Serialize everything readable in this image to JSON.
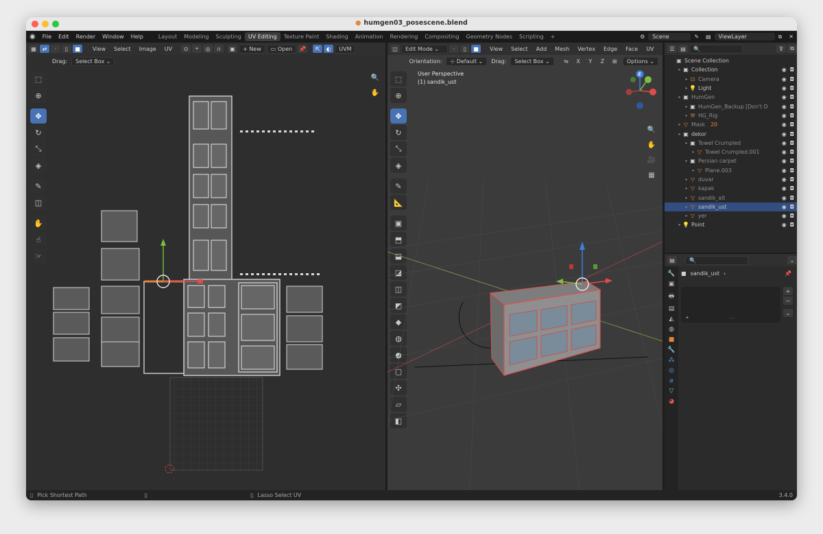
{
  "window": {
    "title": "humgen03_posescene.blend"
  },
  "topbar": {
    "menus": [
      "File",
      "Edit",
      "Render",
      "Window",
      "Help"
    ],
    "workspaces": [
      "Layout",
      "Modeling",
      "Sculpting",
      "UV Editing",
      "Texture Paint",
      "Shading",
      "Animation",
      "Rendering",
      "Compositing",
      "Geometry Nodes",
      "Scripting"
    ],
    "active_workspace": "UV Editing",
    "add_label": "+",
    "scene": "Scene",
    "view_layer": "ViewLayer"
  },
  "uv_editor": {
    "menus": [
      "View",
      "Select",
      "Image",
      "UV"
    ],
    "new_label": "New",
    "open_label": "Open",
    "uv_map_label": "UVM",
    "drag_label": "Drag:",
    "drag_mode": "Select Box"
  },
  "viewport": {
    "mode": "Edit Mode",
    "menus": [
      "View",
      "Select",
      "Add",
      "Mesh",
      "Vertex",
      "Edge",
      "Face",
      "UV"
    ],
    "orientation_label": "Orientation:",
    "orientation_value": "Default",
    "drag_label": "Drag:",
    "drag_mode": "Select Box",
    "axes": [
      "X",
      "Y",
      "Z"
    ],
    "options_label": "Options",
    "overlay_line1": "User Perspective",
    "overlay_line2": "(1) sandik_ust",
    "gizmo_axis_label": "Z"
  },
  "outliner": {
    "root": "Scene Collection",
    "rows": [
      {
        "label": "Collection",
        "indent": 1,
        "icon": "collection-icon",
        "dim": false
      },
      {
        "label": "Camera",
        "indent": 2,
        "icon": "camera-icon",
        "dim": true
      },
      {
        "label": "Light",
        "indent": 2,
        "icon": "light-icon",
        "dim": false
      },
      {
        "label": "HumGen",
        "indent": 1,
        "icon": "collection-icon",
        "dim": true
      },
      {
        "label": "HumGen_Backup [Don't D",
        "indent": 2,
        "icon": "collection-icon",
        "dim": true
      },
      {
        "label": "HG_Rig",
        "indent": 2,
        "icon": "armature-icon",
        "dim": true
      },
      {
        "label": "Mask",
        "indent": 1,
        "icon": "mesh-icon",
        "dim": true
      },
      {
        "label": "dekor",
        "indent": 1,
        "icon": "collection-icon",
        "dim": false
      },
      {
        "label": "Towel Crumpled",
        "indent": 2,
        "icon": "collection-icon",
        "dim": true
      },
      {
        "label": "Towel Crumpled.001",
        "indent": 3,
        "icon": "mesh-icon",
        "dim": true
      },
      {
        "label": "Persian carpet",
        "indent": 2,
        "icon": "collection-icon",
        "dim": true
      },
      {
        "label": "Plane.003",
        "indent": 3,
        "icon": "mesh-icon",
        "dim": true
      },
      {
        "label": "duvar",
        "indent": 2,
        "icon": "mesh-icon",
        "dim": true
      },
      {
        "label": "kapak",
        "indent": 2,
        "icon": "mesh-icon",
        "dim": true
      },
      {
        "label": "sandik_alt",
        "indent": 2,
        "icon": "mesh-icon",
        "dim": true
      },
      {
        "label": "sandik_ust",
        "indent": 2,
        "icon": "mesh-icon",
        "dim": false,
        "selected": true
      },
      {
        "label": "yer",
        "indent": 2,
        "icon": "mesh-icon",
        "dim": true
      },
      {
        "label": "Point",
        "indent": 1,
        "icon": "light-icon",
        "dim": false
      }
    ],
    "mask_badge": "20"
  },
  "properties": {
    "object_name": "sandik_ust",
    "list_dots": "⋯"
  },
  "statusbar": {
    "left": "Pick Shortest Path",
    "middle": "Lasso Select UV",
    "version": "3.4.0"
  }
}
